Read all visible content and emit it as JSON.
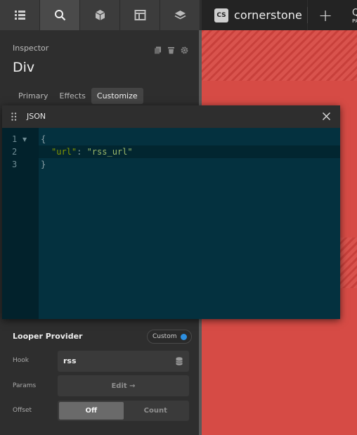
{
  "brand": {
    "badge": "CS",
    "name": "cornerstone"
  },
  "topbar": {
    "plus": "+",
    "q_letter": "Q",
    "q_sub": "PA"
  },
  "toolbar_icons": [
    "list-icon",
    "search-icon",
    "cube-icon",
    "layout-icon",
    "layers-icon"
  ],
  "inspector": {
    "label": "Inspector",
    "title": "Div",
    "tabs": [
      {
        "label": "Primary"
      },
      {
        "label": "Effects"
      },
      {
        "label": "Customize"
      }
    ]
  },
  "looper": {
    "title": "Looper Provider",
    "badge": "Custom",
    "hook_label": "Hook",
    "hook_value": "rss",
    "params_label": "Params",
    "params_button": "Edit →",
    "offset_label": "Offset",
    "offset_options": [
      "Off",
      "Count"
    ],
    "offset_selected": "Off"
  },
  "json_modal": {
    "title": "JSON",
    "line_numbers": [
      "1",
      "2",
      "3"
    ],
    "open_brace": "{",
    "key": "\"url\"",
    "colon": ": ",
    "value": "\"rss_url\"",
    "close_brace": "}"
  },
  "colors": {
    "accent": "#2d8fe0",
    "preview_red": "#d64b45",
    "editor_bg": "#04313f"
  }
}
